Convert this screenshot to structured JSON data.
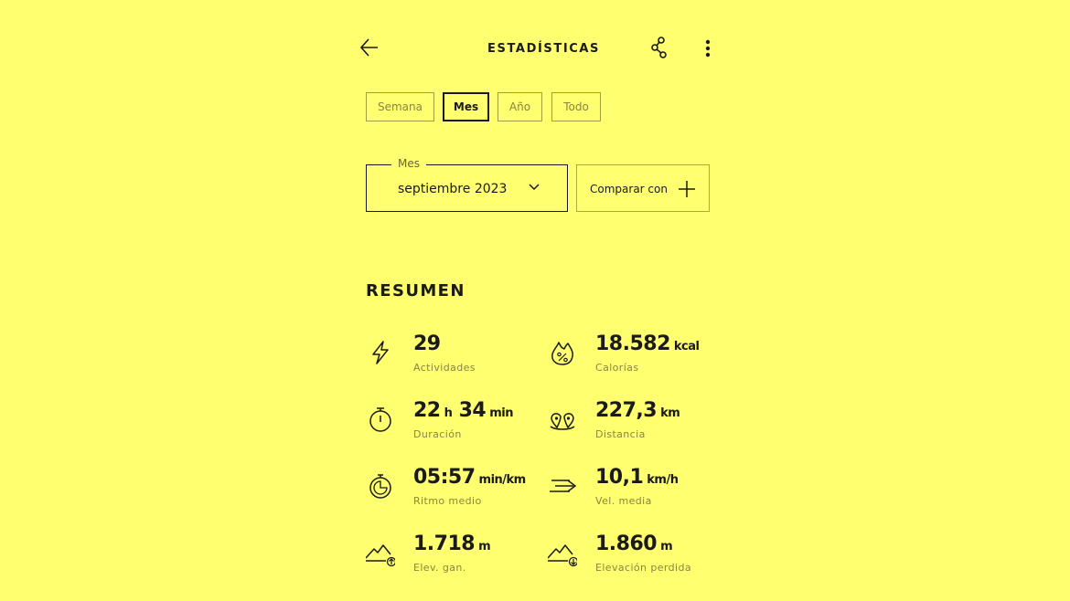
{
  "header": {
    "title": "ESTADÍSTICAS",
    "back_icon": "arrow-left-icon",
    "share_icon": "share-icon",
    "more_icon": "more-vertical-icon"
  },
  "tabs": [
    {
      "label": "Semana",
      "active": false
    },
    {
      "label": "Mes",
      "active": true
    },
    {
      "label": "Año",
      "active": false
    },
    {
      "label": "Todo",
      "active": false
    }
  ],
  "month_selector": {
    "legend": "Mes",
    "value": "septiembre 2023",
    "icon": "chevron-down-icon"
  },
  "compare": {
    "label": "Comparar con",
    "icon": "plus-icon"
  },
  "summary": {
    "title": "RESUMEN",
    "activities": {
      "v1": "29",
      "label": "Actividades",
      "icon": "lightning-icon"
    },
    "calories": {
      "v1": "18.582",
      "u1": "kcal",
      "label": "Calorías",
      "icon": "flame-percent-icon"
    },
    "duration": {
      "v1": "22",
      "u1": "h",
      "v2": "34",
      "u2": "min",
      "label": "Duración",
      "icon": "stopwatch-icon"
    },
    "distance": {
      "v1": "227,3",
      "u1": "km",
      "label": "Distancia",
      "icon": "route-pins-icon"
    },
    "pace": {
      "v1": "05:57",
      "u1": "min/km",
      "label": "Ritmo medio",
      "icon": "pace-clock-icon"
    },
    "speed": {
      "v1": "10,1",
      "u1": "km/h",
      "label": "Vel. media",
      "icon": "speed-arrow-icon"
    },
    "elev_gain": {
      "v1": "1.718",
      "u1": "m",
      "label": "Elev. gan.",
      "icon": "mountain-up-icon"
    },
    "elev_loss": {
      "v1": "1.860",
      "u1": "m",
      "label": "Elevación perdida",
      "icon": "mountain-down-icon"
    }
  },
  "colors": {
    "background": "#ffff70",
    "text": "#1a1a1a",
    "muted": "#8a8442"
  }
}
